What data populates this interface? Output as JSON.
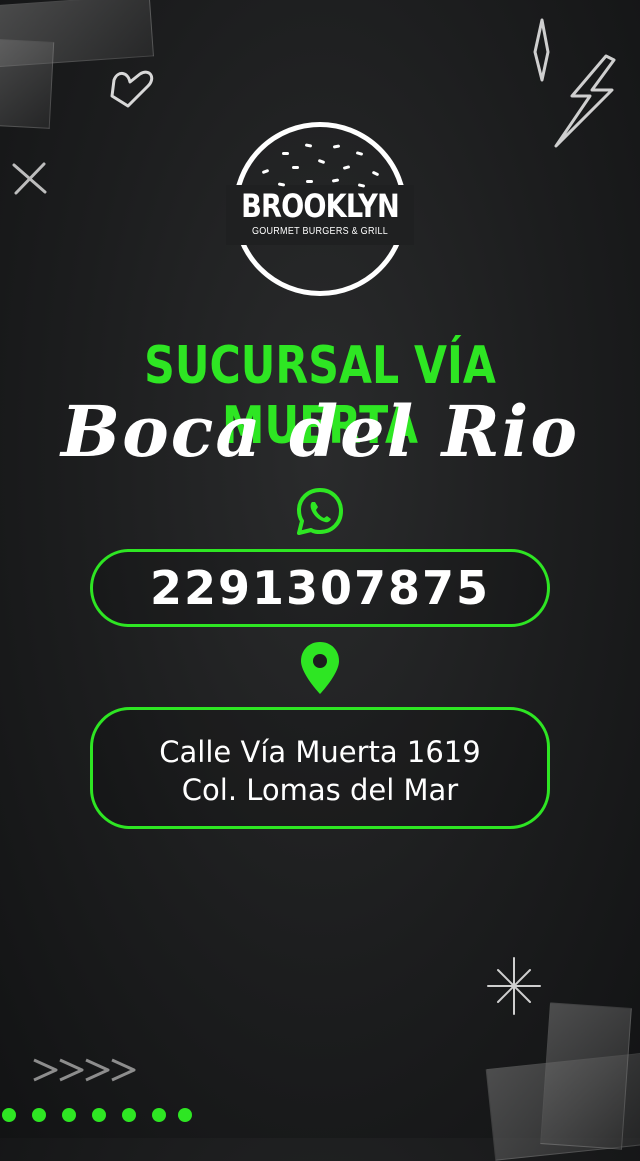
{
  "brand": {
    "name": "BROOKLYN",
    "tagline": "GOURMET BURGERS & GRILL"
  },
  "headline": "SUCURSAL VÍA MUERTA",
  "location_script": "Boca del Rio",
  "contact": {
    "phone_icon": "whatsapp-icon",
    "phone": "2291307875",
    "address_icon": "map-pin-icon",
    "address_line1": "Calle Vía Muerta 1619",
    "address_line2": "Col. Lomas del Mar"
  },
  "colors": {
    "accent_green": "#2ee623",
    "background": "#1c1d1e",
    "text": "#ffffff"
  }
}
